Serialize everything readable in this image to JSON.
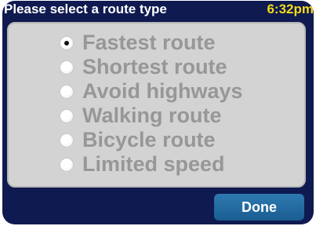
{
  "header": {
    "title": "Please select a route type",
    "time": "6:32pm"
  },
  "route_options": [
    {
      "label": "Fastest route",
      "selected": true
    },
    {
      "label": "Shortest route",
      "selected": false
    },
    {
      "label": "Avoid highways",
      "selected": false
    },
    {
      "label": "Walking route",
      "selected": false
    },
    {
      "label": "Bicycle route",
      "selected": false
    },
    {
      "label": "Limited speed",
      "selected": false
    }
  ],
  "footer": {
    "done_label": "Done"
  },
  "colors": {
    "background": "#0f1a50",
    "panel": "#d3d3d3",
    "option_text": "#979797",
    "clock": "#f2d91c",
    "button": "#1f6aa3"
  }
}
